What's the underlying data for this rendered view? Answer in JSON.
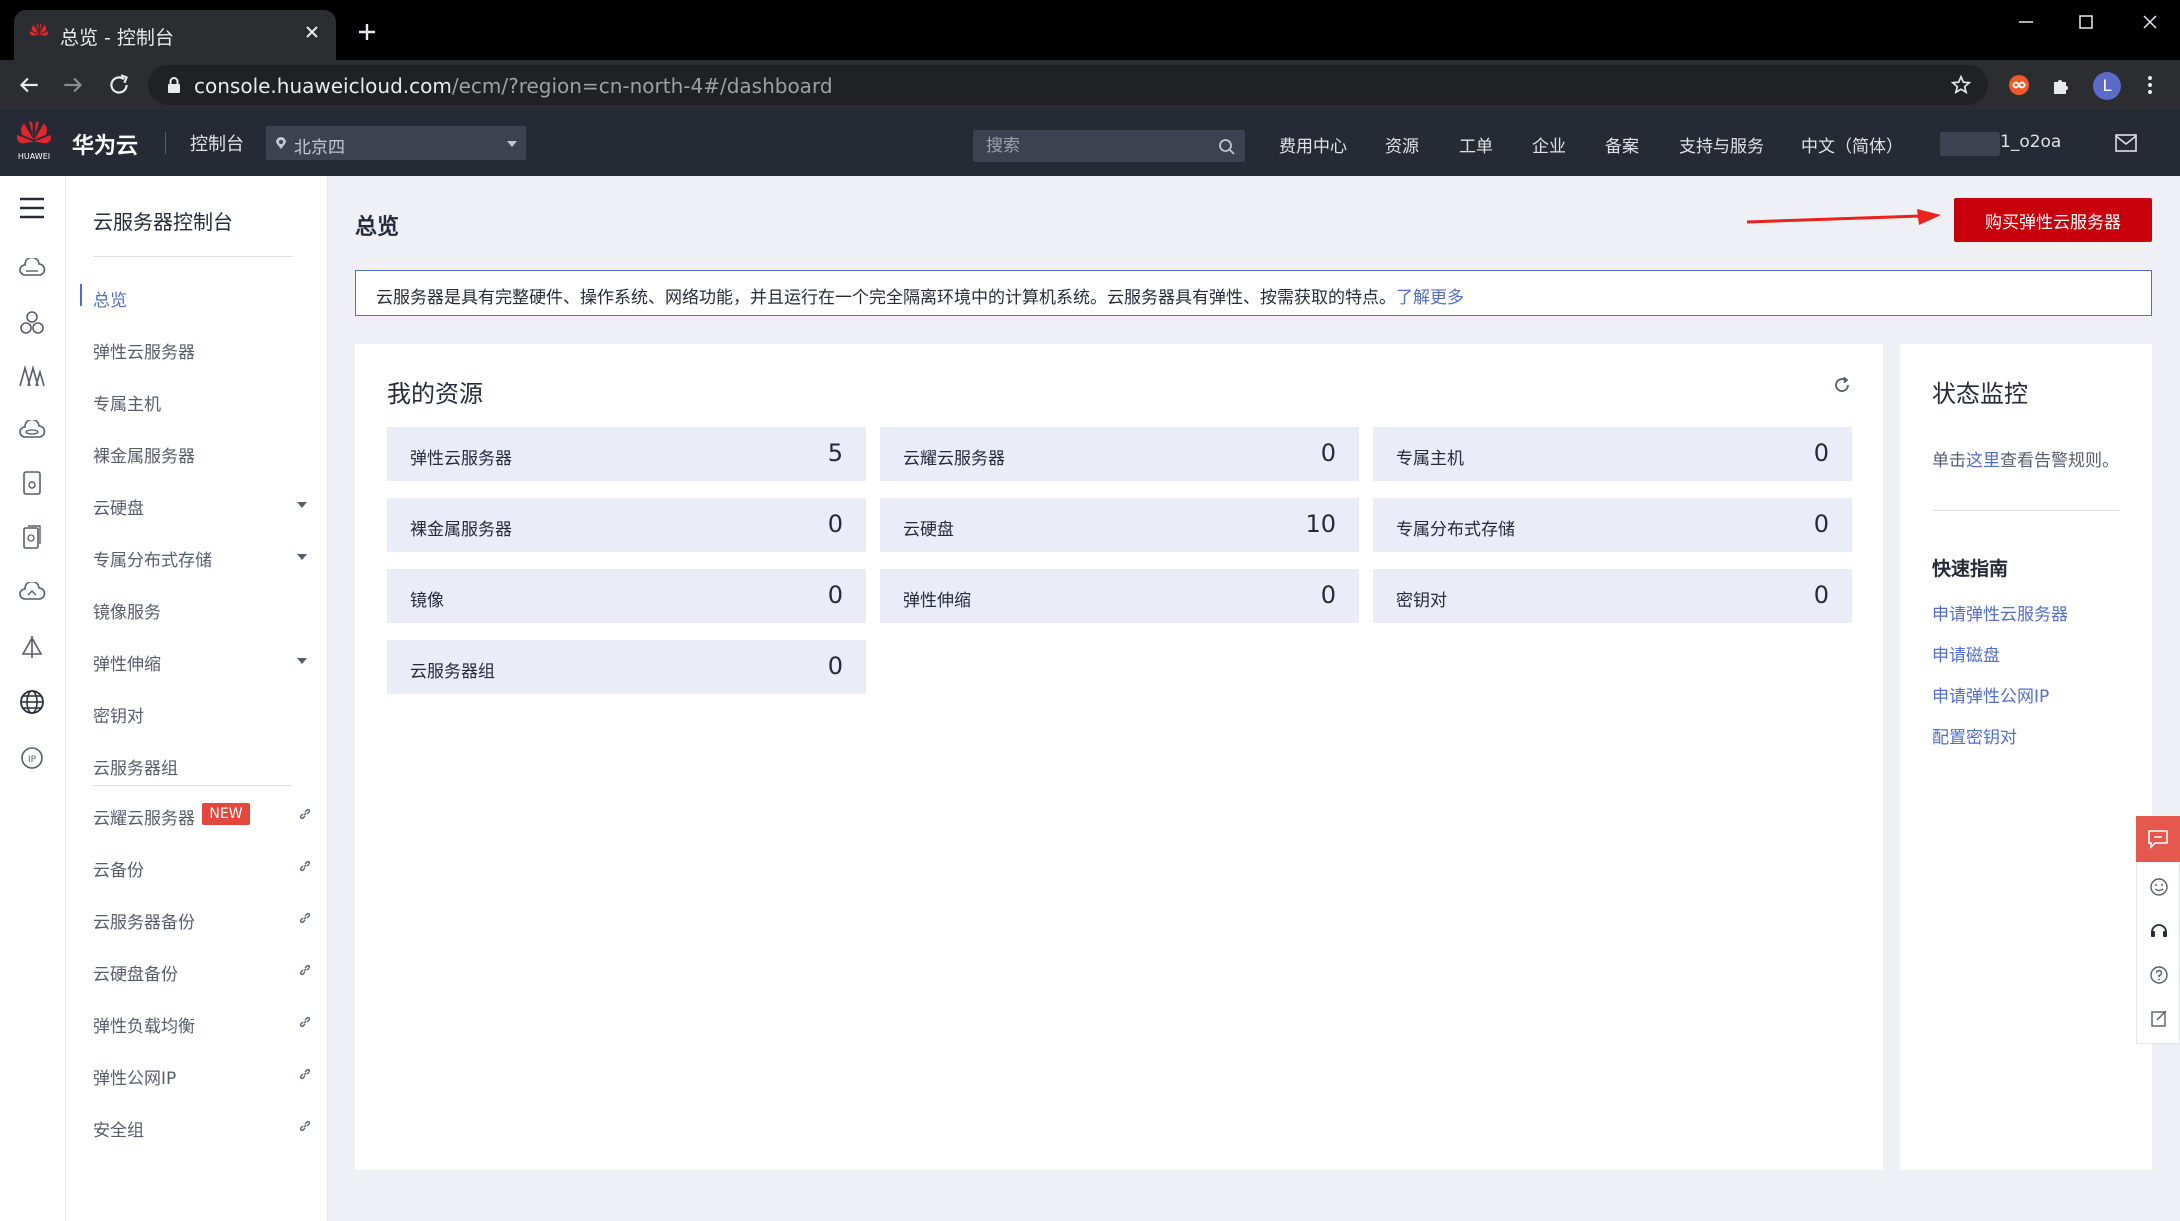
{
  "browser": {
    "tab_title": "总览 - 控制台",
    "url_host": "console.huaweicloud.com",
    "url_path": "/ecm/?region=cn-north-4#/dashboard",
    "profile_initial": "L"
  },
  "header": {
    "logo_text": "HUAWEI",
    "brand": "华为云",
    "console": "控制台",
    "region": "北京四",
    "search_placeholder": "搜索",
    "nav": [
      "费用中心",
      "资源",
      "工单",
      "企业",
      "备案",
      "支持与服务",
      "中文（简体）"
    ],
    "user_suffix": "1_o2oa"
  },
  "sidebar": {
    "title": "云服务器控制台",
    "items": [
      {
        "label": "总览",
        "active": true
      },
      {
        "label": "弹性云服务器"
      },
      {
        "label": "专属主机"
      },
      {
        "label": "裸金属服务器"
      },
      {
        "label": "云硬盘",
        "expandable": true
      },
      {
        "label": "专属分布式存储",
        "expandable": true
      },
      {
        "label": "镜像服务"
      },
      {
        "label": "弹性伸缩",
        "expandable": true
      },
      {
        "label": "密钥对"
      },
      {
        "label": "云服务器组"
      }
    ],
    "external_items": [
      {
        "label": "云耀云服务器",
        "badge": "NEW"
      },
      {
        "label": "云备份"
      },
      {
        "label": "云服务器备份"
      },
      {
        "label": "云硬盘备份"
      },
      {
        "label": "弹性负载均衡"
      },
      {
        "label": "弹性公网IP"
      },
      {
        "label": "安全组"
      }
    ]
  },
  "main": {
    "title": "总览",
    "buy_button": "购买弹性云服务器",
    "notice": "云服务器是具有完整硬件、操作系统、网络功能，并且运行在一个完全隔离环境中的计算机系统。云服务器具有弹性、按需获取的特点。",
    "notice_link": "了解更多",
    "resources_title": "我的资源",
    "resources": [
      {
        "label": "弹性云服务器",
        "value": "5"
      },
      {
        "label": "云耀云服务器",
        "value": "0"
      },
      {
        "label": "专属主机",
        "value": "0"
      },
      {
        "label": "裸金属服务器",
        "value": "0"
      },
      {
        "label": "云硬盘",
        "value": "10"
      },
      {
        "label": "专属分布式存储",
        "value": "0"
      },
      {
        "label": "镜像",
        "value": "0"
      },
      {
        "label": "弹性伸缩",
        "value": "0"
      },
      {
        "label": "密钥对",
        "value": "0"
      },
      {
        "label": "云服务器组",
        "value": "0"
      }
    ]
  },
  "monitor": {
    "title": "状态监控",
    "desc_prefix": "单击",
    "desc_link": "这里",
    "desc_suffix": "查看告警规则。",
    "guide_title": "快速指南",
    "guides": [
      "申请弹性云服务器",
      "申请磁盘",
      "申请弹性公网IP",
      "配置密钥对"
    ]
  },
  "colors": {
    "accent": "#526ecc",
    "buy_button": "#c7000b",
    "header_bg": "#252a35",
    "resource_tile": "#eaedf8"
  }
}
